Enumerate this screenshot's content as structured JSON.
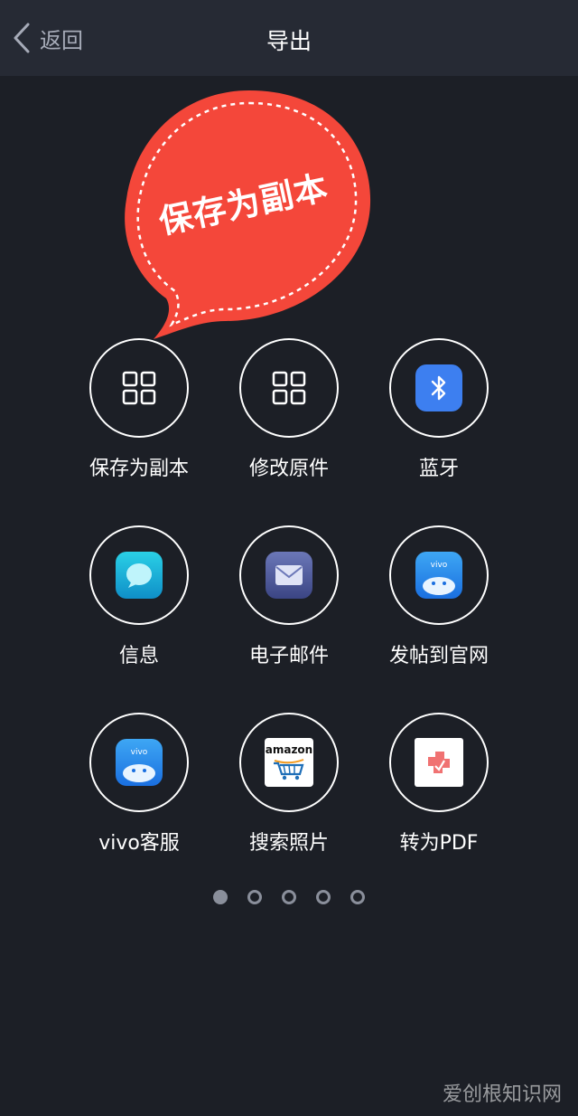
{
  "header": {
    "back_label": "返回",
    "title": "导出"
  },
  "callout": {
    "text": "保存为副本",
    "color": "#f4473a"
  },
  "grid": {
    "items": [
      {
        "label": "保存为副本",
        "icon": "grid-icon"
      },
      {
        "label": "修改原件",
        "icon": "grid-icon"
      },
      {
        "label": "蓝牙",
        "icon": "bluetooth-icon"
      },
      {
        "label": "信息",
        "icon": "message-icon"
      },
      {
        "label": "电子邮件",
        "icon": "email-icon"
      },
      {
        "label": "发帖到官网",
        "icon": "vivo-icon"
      },
      {
        "label": "vivo客服",
        "icon": "vivo-service-icon"
      },
      {
        "label": "搜索照片",
        "icon": "amazon-icon"
      },
      {
        "label": "转为PDF",
        "icon": "pdf-icon"
      }
    ]
  },
  "amazon_icon_text": "amazon",
  "vivo_icon_text": "vivo",
  "pagination": {
    "pages": 5,
    "current": 1
  },
  "watermark": "爱创根知识网",
  "colors": {
    "background": "#1c1f26",
    "header": "#262a34",
    "bluetooth": "#3d7ff0"
  }
}
